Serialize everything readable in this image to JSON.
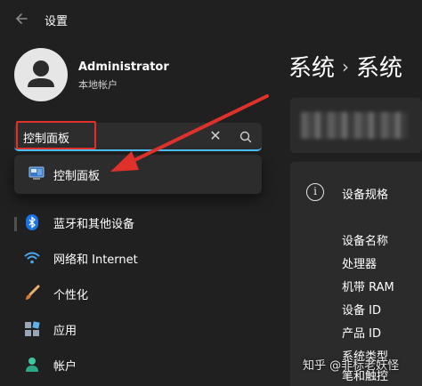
{
  "window": {
    "title": "设置"
  },
  "user": {
    "name": "Administrator",
    "account_type": "本地帐户"
  },
  "search": {
    "value": "控制面板"
  },
  "search_results": [
    {
      "label": "控制面板"
    }
  ],
  "nav": [
    {
      "label": "蓝牙和其他设备",
      "icon": "bluetooth-icon"
    },
    {
      "label": "网络和 Internet",
      "icon": "wifi-icon"
    },
    {
      "label": "个性化",
      "icon": "brush-icon"
    },
    {
      "label": "应用",
      "icon": "apps-icon"
    },
    {
      "label": "帐户",
      "icon": "account-icon"
    }
  ],
  "main": {
    "breadcrumb": [
      "系统",
      "系统"
    ],
    "spec_title": "设备规格",
    "specs": [
      "设备名称",
      "处理器",
      "机带 RAM",
      "设备 ID",
      "产品 ID",
      "系统类型",
      "笔和触控"
    ]
  },
  "watermark": "知乎 @非标老妖怪",
  "colors": {
    "background": "#202020",
    "card": "#2b2b2b",
    "accent": "#4cc2ff",
    "annotation": "#e0302a"
  }
}
